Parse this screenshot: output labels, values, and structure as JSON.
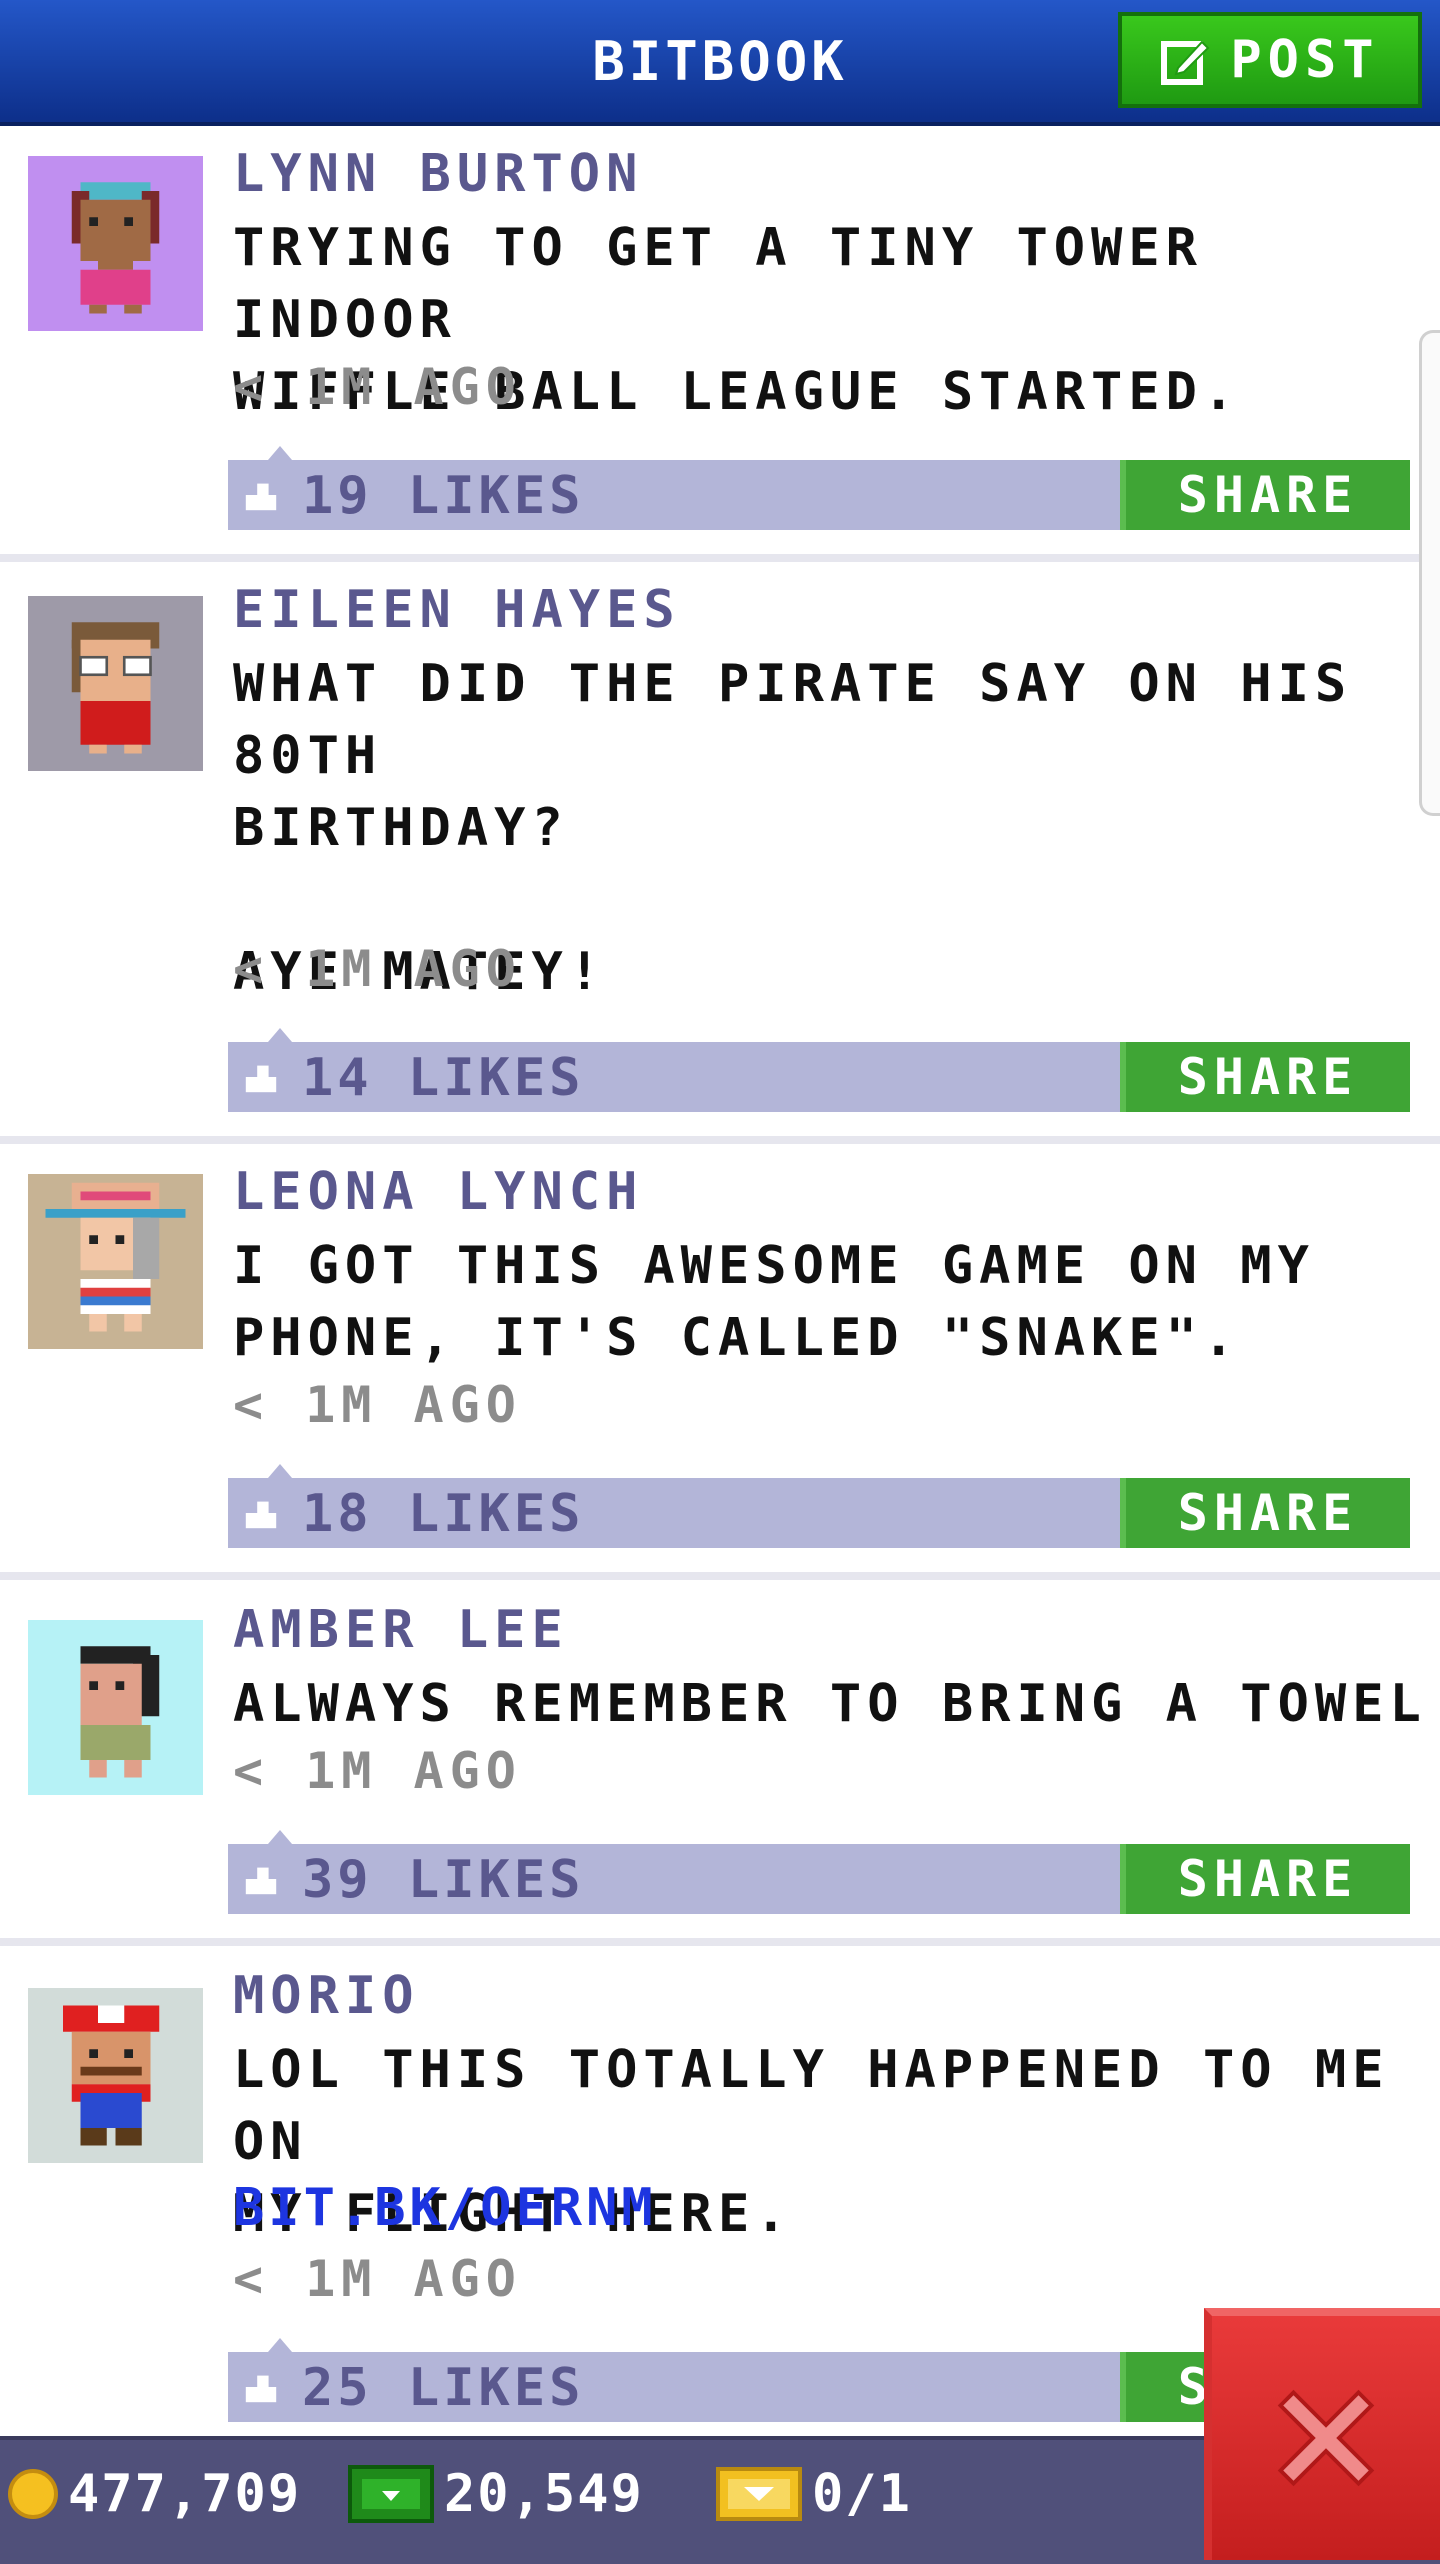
{
  "header": {
    "title": "BITBOOK",
    "post_label": "POST"
  },
  "posts": [
    {
      "author": "LYNN BURTON",
      "text": "TRYING TO GET A TINY TOWER INDOOR\nWIFFLE BALL LEAGUE STARTED.",
      "link": "",
      "time": "< 1M AGO",
      "likes": "19 LIKES",
      "share_label": "SHARE",
      "avatar_bg": "#c08ff0"
    },
    {
      "author": "EILEEN HAYES",
      "text": "WHAT DID THE PIRATE SAY ON HIS 80TH\nBIRTHDAY?\n\nAYE MATEY!",
      "link": "",
      "time": "< 1M AGO",
      "likes": "14 LIKES",
      "share_label": "SHARE",
      "avatar_bg": "#9e9aa8"
    },
    {
      "author": "LEONA LYNCH",
      "text": "I GOT THIS AWESOME GAME ON MY\nPHONE, IT'S CALLED \"SNAKE\".",
      "link": "",
      "time": "< 1M AGO",
      "likes": "18 LIKES",
      "share_label": "SHARE",
      "avatar_bg": "#c7b394"
    },
    {
      "author": "AMBER LEE",
      "text": "ALWAYS REMEMBER TO BRING A TOWEL",
      "link": "",
      "time": "< 1M AGO",
      "likes": "39 LIKES",
      "share_label": "SHARE",
      "avatar_bg": "#b6f2f6"
    },
    {
      "author": "MORIO",
      "text": "LOL THIS TOTALLY HAPPENED TO ME ON\nMY FLIGHT HERE.",
      "link": "BIT.BK/OERNM",
      "time": "< 1M AGO",
      "likes": "25 LIKES",
      "share_label": "SHARE",
      "avatar_bg": "#d2dcd9"
    }
  ],
  "footer": {
    "coins": "477,709",
    "bux": "20,549",
    "tickets": "0/1"
  },
  "icons": {
    "post": "edit-icon",
    "like": "thumbs-up-icon",
    "coins": "coin-icon",
    "bux": "cash-icon",
    "tickets": "ticket-icon",
    "close": "close-icon"
  },
  "colors": {
    "header": "#1a46b0",
    "post_button": "#2fae18",
    "share_button": "#3fa535",
    "like_bar": "#b3b5d8",
    "author": "#5a588e",
    "link": "#1d35e0",
    "footer": "#50507a",
    "close_button": "#d62a2a"
  }
}
